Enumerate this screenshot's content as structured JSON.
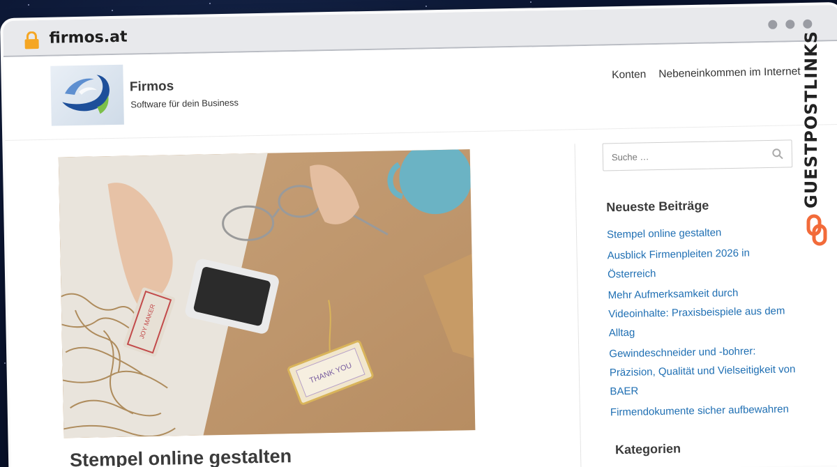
{
  "browser": {
    "url": "firmos.at"
  },
  "site": {
    "title": "Firmos",
    "tagline": "Software für dein Business",
    "nav": [
      "Konten",
      "Nebeneinkommen im Internet"
    ]
  },
  "post": {
    "title": "Stempel online gestalten",
    "image_icons": [
      "stamp-icon",
      "ink-pad-icon",
      "glasses-icon",
      "mug-icon",
      "gift-tag-icon"
    ],
    "stamp_text": "JOY MAKER",
    "tag_text": "THANK YOU"
  },
  "sidebar": {
    "search_placeholder": "Suche …",
    "recent_heading": "Neueste Beiträge",
    "recent_posts": [
      "Stempel online gestalten",
      "Ausblick Firmenpleiten 2026 in Österreich",
      "Mehr Aufmerksamkeit durch Videoinhalte: Praxisbeispiele aus dem Alltag",
      "Gewindeschneider und -bohrer: Präzision, Qualität und Vielseitigkeit von BAER",
      "Firmendokumente sicher aufbewahren"
    ],
    "categories_heading": "Kategorien"
  },
  "watermark": {
    "text": "GUESTPOSTLINKS"
  },
  "colors": {
    "link": "#1f6fb3",
    "accent_orange": "#f26b3a",
    "lock": "#f5a623"
  }
}
